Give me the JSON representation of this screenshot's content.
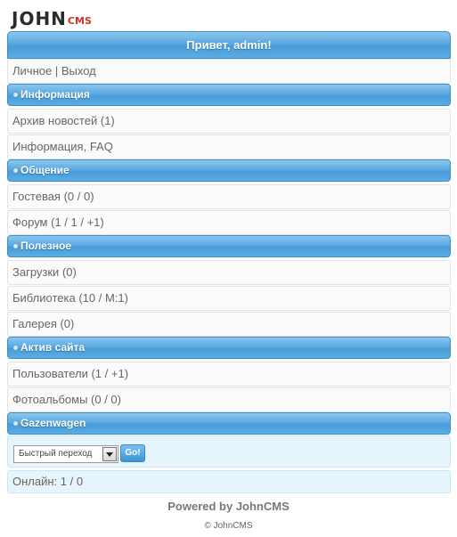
{
  "logo": {
    "main": "JOHN",
    "suffix": "CMS"
  },
  "greeting": {
    "prefix": "Привет, ",
    "user": "admin!"
  },
  "account_links": {
    "personal": "Личное",
    "separator": " | ",
    "logout": "Выход"
  },
  "sections": {
    "info": {
      "title": "Информация",
      "news": {
        "label": "Архив новостей ",
        "count": "(1)"
      },
      "faq": {
        "label": "Информация, FAQ"
      }
    },
    "community": {
      "title": "Общение",
      "guestbook": {
        "label": "Гостевая ",
        "open": "(0 / ",
        "new": "0",
        "close": ")"
      },
      "forum": {
        "label": "Форум ",
        "open": "(1 / 1 / ",
        "new": "+1",
        "close": ")"
      }
    },
    "useful": {
      "title": "Полезное",
      "downloads": {
        "label": "Загрузки ",
        "count": "(0)"
      },
      "library": {
        "label": "Библиотека ",
        "open": "(10 / ",
        "mod": "M:1",
        "close": ")"
      },
      "gallery": {
        "label": "Галерея ",
        "count": "(0)"
      }
    },
    "activity": {
      "title": "Актив сайта",
      "users": {
        "label": "Пользователи ",
        "open": "(1 / ",
        "new": "+1",
        "close": ")"
      },
      "albums": {
        "label": "Фотоальбомы ",
        "count": "(0 / 0)"
      }
    },
    "gazenwagen": {
      "title": "Gazenwagen"
    }
  },
  "quick_jump": {
    "selected": "Быстрый переход",
    "go_label": "Go!"
  },
  "online": {
    "label": "Онлайн: ",
    "value": "1 / 0"
  },
  "footer": {
    "powered": "Powered by JohnCMS",
    "copyright": "© JohnCMS"
  },
  "colors": {
    "accent": "#4a9bd6",
    "link_blue": "#2b72b5",
    "panel_bg": "#e6f5fc"
  }
}
